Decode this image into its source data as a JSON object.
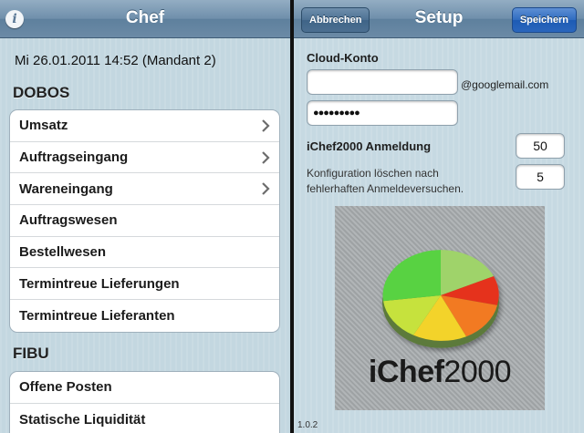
{
  "left": {
    "navbar": {
      "title": "Chef",
      "info_icon": "info-icon"
    },
    "date_line": "Mi 26.01.2011 14:52 (Mandant 2)",
    "sections": [
      {
        "header": "DOBOS",
        "items": [
          {
            "label": "Umsatz",
            "chevron": true
          },
          {
            "label": "Auftragseingang",
            "chevron": true
          },
          {
            "label": "Wareneingang",
            "chevron": true
          },
          {
            "label": "Auftragswesen",
            "chevron": false
          },
          {
            "label": "Bestellwesen",
            "chevron": false
          },
          {
            "label": "Termintreue Lieferungen",
            "chevron": false
          },
          {
            "label": "Termintreue Lieferanten",
            "chevron": false
          }
        ]
      },
      {
        "header": "FIBU",
        "items": [
          {
            "label": "Offene Posten",
            "chevron": false
          },
          {
            "label": "Statische Liquidität",
            "chevron": false
          }
        ]
      }
    ]
  },
  "right": {
    "navbar": {
      "title": "Setup",
      "cancel_label": "Abbrechen",
      "save_label": "Speichern"
    },
    "cloud_label": "Cloud-Konto",
    "email_value": "",
    "email_suffix": "@googlemail.com",
    "password_value": "●●●●●●●●●",
    "login_label": "iChef2000 Anmeldung",
    "login_value": "50",
    "reset_desc_line1": "Konfiguration löschen nach",
    "reset_desc_line2": "fehlerhaften Anmeldeversuchen.",
    "reset_value": "5",
    "logo": {
      "text_bold": "iChef",
      "text_light": "2000"
    },
    "version": "1.0.2"
  },
  "colors": {
    "navbar": "#6b8aa6",
    "save_button": "#2a66bd",
    "background": "#c3d7e0"
  }
}
